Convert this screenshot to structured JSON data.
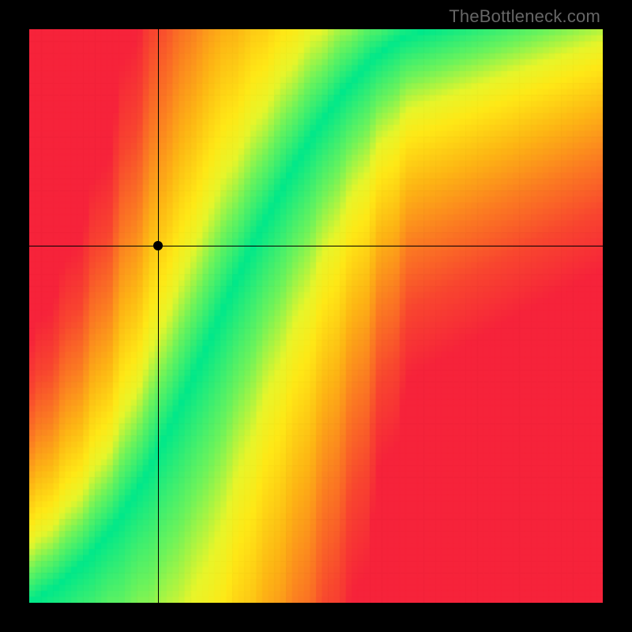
{
  "watermark": "TheBottleneck.com",
  "chart_data": {
    "type": "heatmap",
    "title": "",
    "xlabel": "",
    "ylabel": "",
    "xlim": [
      0,
      1
    ],
    "ylim": [
      0,
      1
    ],
    "crosshair": {
      "x": 0.225,
      "y": 0.622
    },
    "marker": {
      "x": 0.225,
      "y": 0.622
    },
    "optimal_curve_description": "A narrow superlinear band where balance is optimal (green), surrounded by a smooth gradient from yellow through orange to red as imbalance grows. The band runs from near the origin steeply upward toward the upper-middle-right.",
    "optimal_curve_points": [
      {
        "x": 0.0,
        "y": 0.0
      },
      {
        "x": 0.05,
        "y": 0.03
      },
      {
        "x": 0.1,
        "y": 0.075
      },
      {
        "x": 0.15,
        "y": 0.135
      },
      {
        "x": 0.2,
        "y": 0.215
      },
      {
        "x": 0.25,
        "y": 0.315
      },
      {
        "x": 0.3,
        "y": 0.425
      },
      {
        "x": 0.35,
        "y": 0.54
      },
      {
        "x": 0.4,
        "y": 0.645
      },
      {
        "x": 0.45,
        "y": 0.74
      },
      {
        "x": 0.5,
        "y": 0.825
      },
      {
        "x": 0.55,
        "y": 0.895
      },
      {
        "x": 0.6,
        "y": 0.95
      },
      {
        "x": 0.65,
        "y": 0.985
      },
      {
        "x": 0.7,
        "y": 1.0
      }
    ],
    "color_stops": [
      {
        "t": 0.0,
        "color": "#00E88A"
      },
      {
        "t": 0.12,
        "color": "#6CF35B"
      },
      {
        "t": 0.22,
        "color": "#E7F52A"
      },
      {
        "t": 0.3,
        "color": "#FEE816"
      },
      {
        "t": 0.45,
        "color": "#FDB514"
      },
      {
        "t": 0.62,
        "color": "#FB7A22"
      },
      {
        "t": 0.8,
        "color": "#F8452F"
      },
      {
        "t": 1.0,
        "color": "#F6233A"
      }
    ],
    "grid_resolution": 96
  }
}
